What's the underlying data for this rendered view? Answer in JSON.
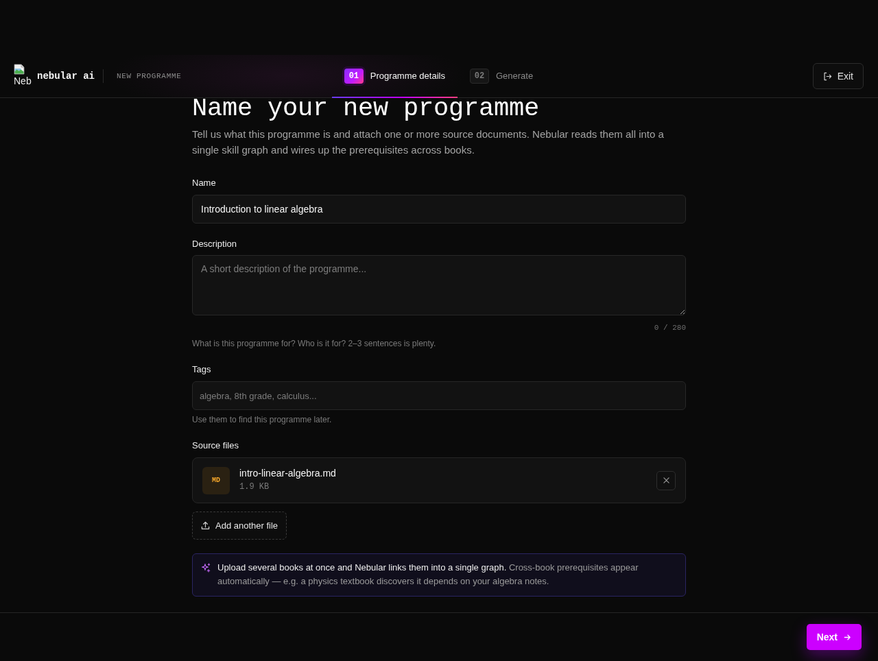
{
  "header": {
    "logo_alt": "Neb",
    "brand": "nebular ai",
    "section": "NEW PROGRAMME",
    "steps": [
      {
        "number": "01",
        "label": "Programme details",
        "selected": true
      },
      {
        "number": "02",
        "label": "Generate",
        "selected": false
      }
    ],
    "exit_button": "Exit"
  },
  "page": {
    "title": "Name your new programme",
    "intro": "Tell us what this programme is and attach one or more source documents. Nebular reads them all into a single skill graph and wires up the prerequisites across books."
  },
  "name_field": {
    "label": "Name",
    "value": "Introduction to linear algebra"
  },
  "description_field": {
    "label": "Description",
    "placeholder": "A short description of the programme...",
    "counter": "0 / 280",
    "hint": "What is this programme for? Who is it for? 2–3 sentences is plenty."
  },
  "tags_field": {
    "label": "Tags",
    "placeholder": "algebra, 8th grade, calculus...",
    "hint": "Use them to find this programme later."
  },
  "source_files": {
    "label": "Source files",
    "files": [
      {
        "badge": "MD",
        "name": "intro-linear-algebra.md",
        "size": "1.9 KB"
      }
    ],
    "add_button": "Add another file"
  },
  "notice": {
    "text": "**Upload several books at once and Nebular links them into a single graph.** Cross-book prerequisites appear automatically — e.g. a physics textbook discovers it depends on your algebra notes."
  },
  "footer": {
    "next_button": "Next"
  }
}
